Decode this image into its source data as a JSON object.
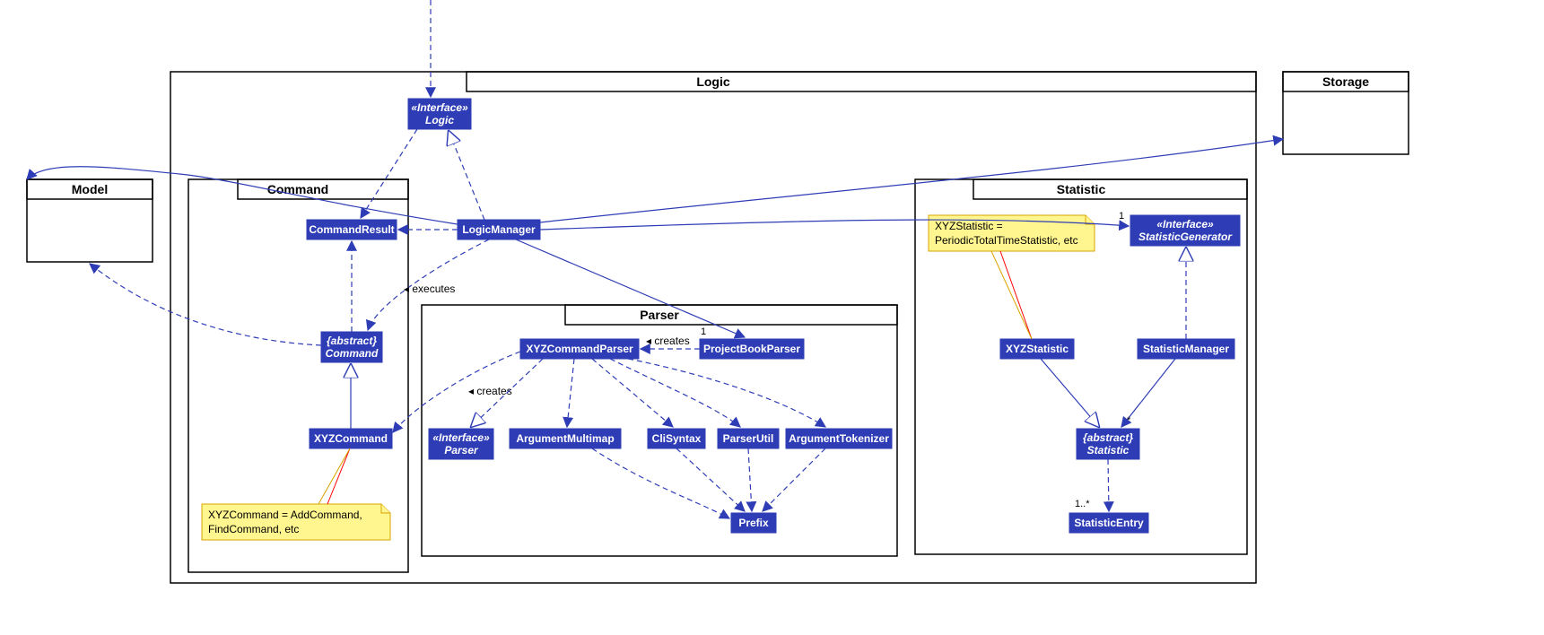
{
  "packages": {
    "logic": "Logic",
    "model": "Model",
    "storage": "Storage",
    "command": "Command",
    "parser": "Parser",
    "statistic": "Statistic"
  },
  "nodes": {
    "logicIf": {
      "stereo": "«Interface»",
      "name": "Logic"
    },
    "logicMgr": "LogicManager",
    "cmdResult": "CommandResult",
    "cmdAbs": {
      "stereo": "{abstract}",
      "name": "Command"
    },
    "xyzCmd": "XYZCommand",
    "xyzParser": "XYZCommandParser",
    "pbParser": "ProjectBookParser",
    "parserIf": {
      "stereo": "«Interface»",
      "name": "Parser"
    },
    "argMulti": "ArgumentMultimap",
    "cliSyn": "CliSyntax",
    "parserUtil": "ParserUtil",
    "argTok": "ArgumentTokenizer",
    "prefix": "Prefix",
    "statGenIf": {
      "stereo": "«Interface»",
      "name": "StatisticGenerator"
    },
    "xyzStat": "XYZStatistic",
    "statMgr": "StatisticManager",
    "statAbs": {
      "stereo": "{abstract}",
      "name": "Statistic"
    },
    "statEntry": "StatisticEntry"
  },
  "labels": {
    "executes": "◂ executes",
    "creates1": "◂ creates",
    "creates2": "◂ creates"
  },
  "mult": {
    "one": "1",
    "star": "*",
    "oneStar": "1..*"
  },
  "notes": {
    "cmdNote": {
      "l1": "XYZCommand = AddCommand,",
      "l2": "FindCommand, etc"
    },
    "statNote": {
      "l1": "XYZStatistic =",
      "l2": "PeriodicTotalTimeStatistic, etc"
    }
  }
}
